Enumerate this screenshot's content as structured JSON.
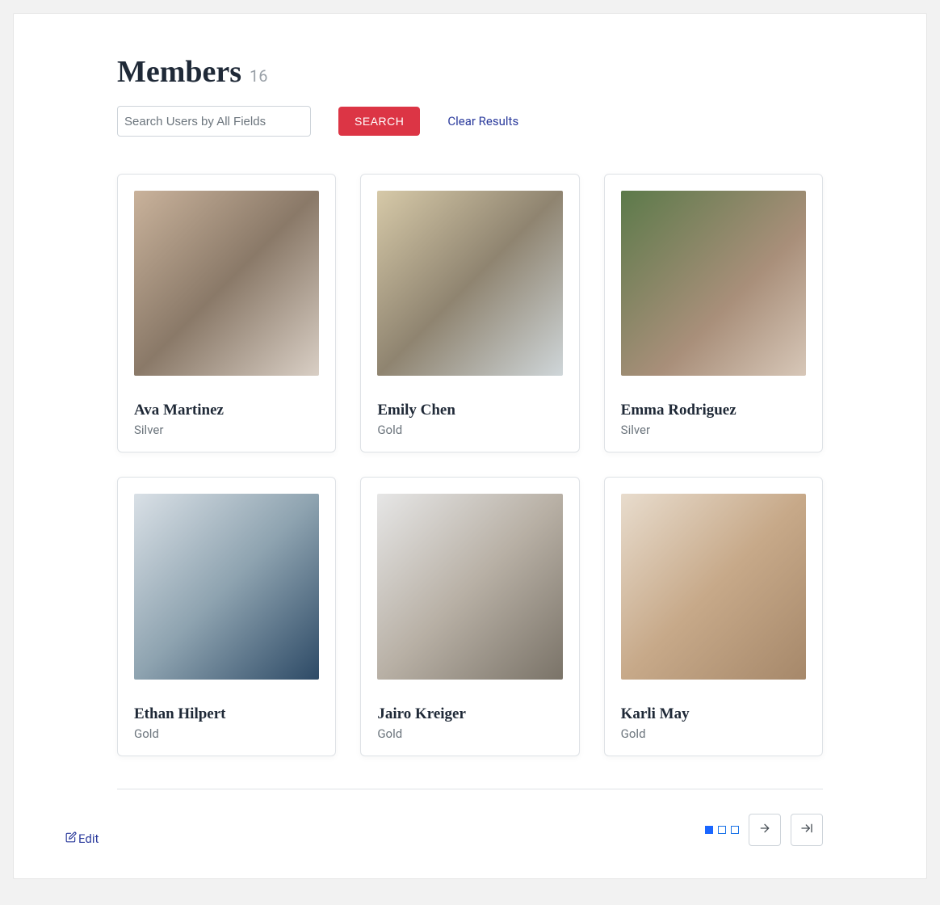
{
  "header": {
    "title": "Members",
    "count": "16"
  },
  "controls": {
    "search_placeholder": "Search Users by All Fields",
    "search_button": "SEARCH",
    "clear_results": "Clear Results"
  },
  "members": [
    {
      "name": "Ava Martinez",
      "tier": "Silver"
    },
    {
      "name": "Emily Chen",
      "tier": "Gold"
    },
    {
      "name": "Emma Rodriguez",
      "tier": "Silver"
    },
    {
      "name": "Ethan Hilpert",
      "tier": "Gold"
    },
    {
      "name": "Jairo Kreiger",
      "tier": "Gold"
    },
    {
      "name": "Karli May",
      "tier": "Gold"
    }
  ],
  "pagination": {
    "pages": 3,
    "current": 1
  },
  "footer": {
    "edit_label": "Edit"
  }
}
